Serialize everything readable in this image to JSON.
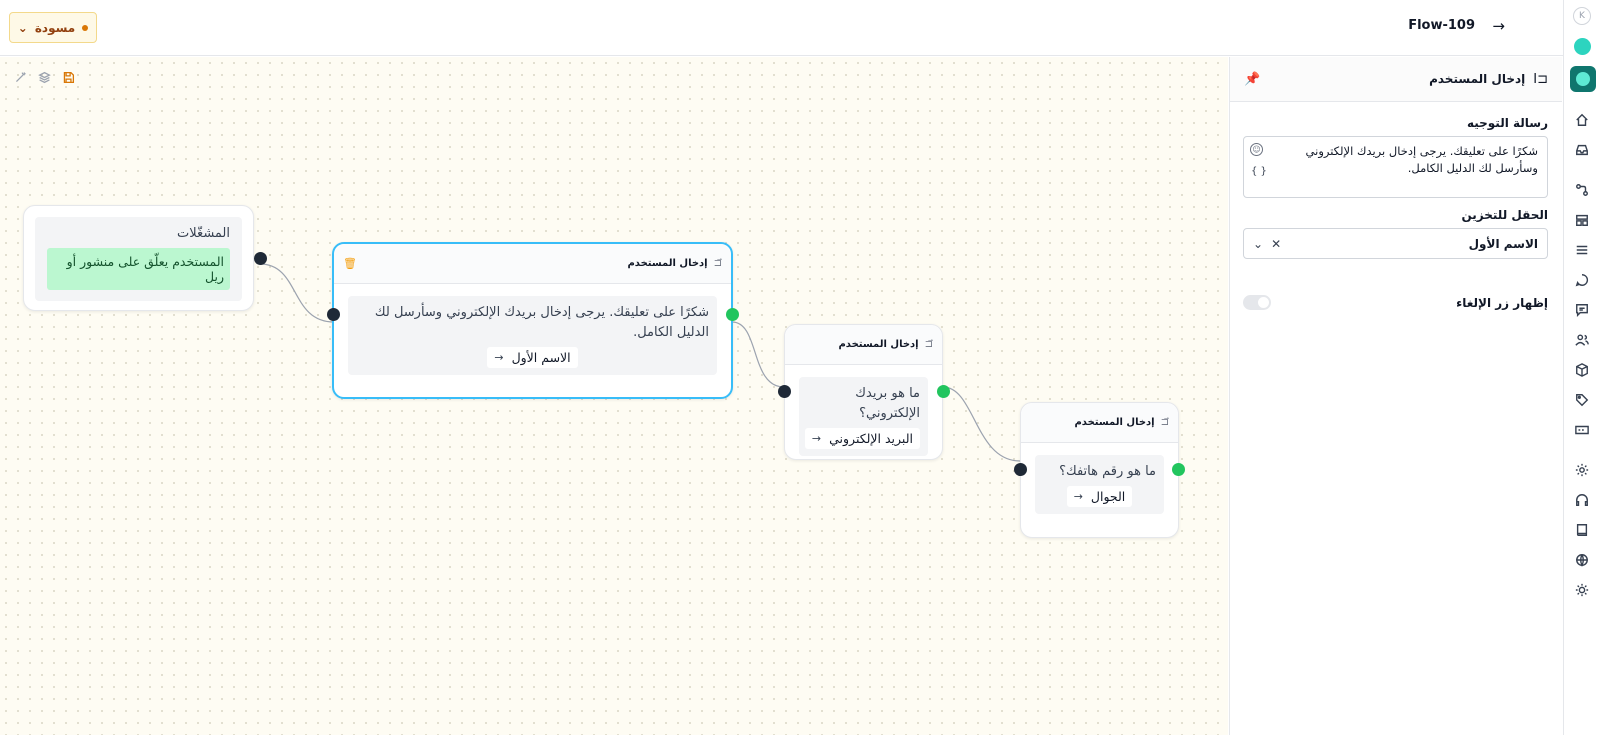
{
  "header": {
    "flow_title": "Flow-109",
    "back_icon": "arrow-right-icon",
    "draft_label": "مسودة",
    "draft_status_color": "#d97706"
  },
  "panel": {
    "title": "إدخال المستخدم",
    "icon": "text-cursor-input-icon",
    "pin_icon": "pin-icon",
    "prompt_label": "رسالة التوجيه",
    "prompt_value": "شكرًا على تعليقك. يرجى إدخال بريدك الإلكتروني وسأرسل لك الدليل الكامل.",
    "vars_token": "{ }",
    "store_label": "الحقل للتخزين",
    "store_value": "الاسم الأول",
    "cancel_label": "إظهار زر الإلغاء",
    "cancel_enabled": false
  },
  "canvas": {
    "trigger": {
      "title": "المشغّلات",
      "event": "المستخدم يعلّق على منشور أو ريل",
      "pill_color": "#bbf7d0"
    },
    "nodes": [
      {
        "title": "إدخال المستخدم",
        "message": "شكرًا على تعليقك. يرجى إدخال بريدك الإلكتروني وسأرسل لك الدليل الكامل.",
        "field": "الاسم الأول",
        "selected": true
      },
      {
        "title": "إدخال المستخدم",
        "message": "ما هو بريدك الإلكتروني؟",
        "field": "البريد الإلكتروني",
        "selected": false
      },
      {
        "title": "إدخال المستخدم",
        "message": "ما هو رقم هاتفك؟",
        "field": "الجوال",
        "selected": false
      }
    ],
    "accent_selected": "#38bdf8",
    "handle_out_color": "#22c55e"
  },
  "rail": {
    "letter": "K",
    "icons": [
      "home-icon",
      "inbox-icon",
      "flows-icon",
      "templates-icon",
      "list-icon",
      "chat-icon",
      "comments-icon",
      "contacts-icon",
      "package-icon",
      "tag-icon",
      "card-icon",
      "settings-icon",
      "headset-icon",
      "book-icon",
      "globe-icon",
      "sun-icon"
    ]
  }
}
